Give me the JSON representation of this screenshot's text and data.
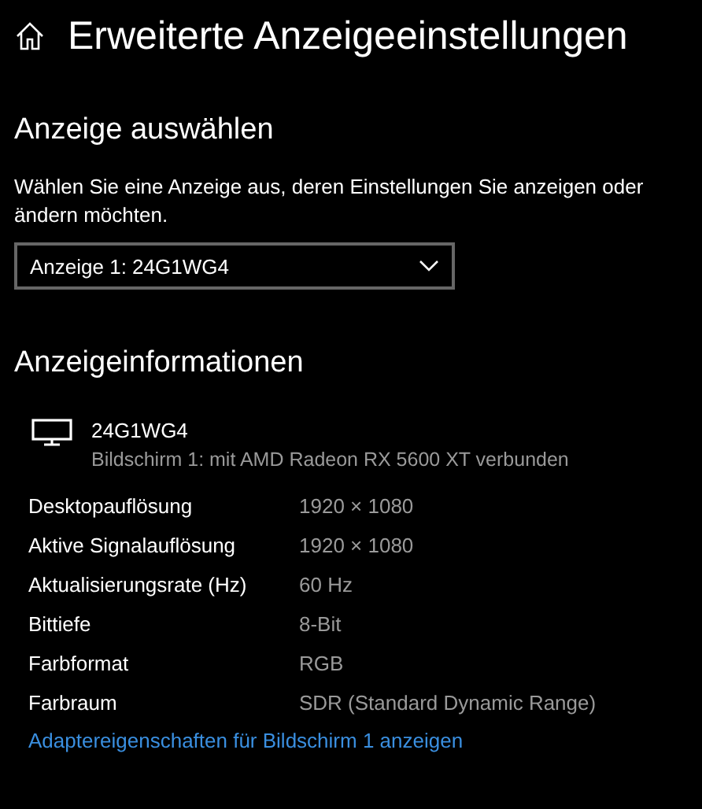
{
  "page_title": "Erweiterte Anzeigeeinstellungen",
  "select_section": {
    "heading": "Anzeige auswählen",
    "description": "Wählen Sie eine Anzeige aus, deren Einstellungen Sie anzeigen oder ändern möchten.",
    "dropdown": {
      "value": "Anzeige 1: 24G1WG4"
    }
  },
  "info_section": {
    "heading": "Anzeigeinformationen",
    "monitor": {
      "name": "24G1WG4",
      "subtitle": "Bildschirm 1: mit AMD Radeon RX 5600 XT verbunden"
    },
    "rows": [
      {
        "label": "Desktopauflösung",
        "value": "1920 × 1080"
      },
      {
        "label": "Aktive Signalauflösung",
        "value": "1920 × 1080"
      },
      {
        "label": "Aktualisierungsrate (Hz)",
        "value": "60 Hz"
      },
      {
        "label": "Bittiefe",
        "value": "8-Bit"
      },
      {
        "label": "Farbformat",
        "value": "RGB"
      },
      {
        "label": "Farbraum",
        "value": "SDR (Standard Dynamic Range)"
      }
    ],
    "link": "Adaptereigenschaften für Bildschirm 1 anzeigen"
  }
}
